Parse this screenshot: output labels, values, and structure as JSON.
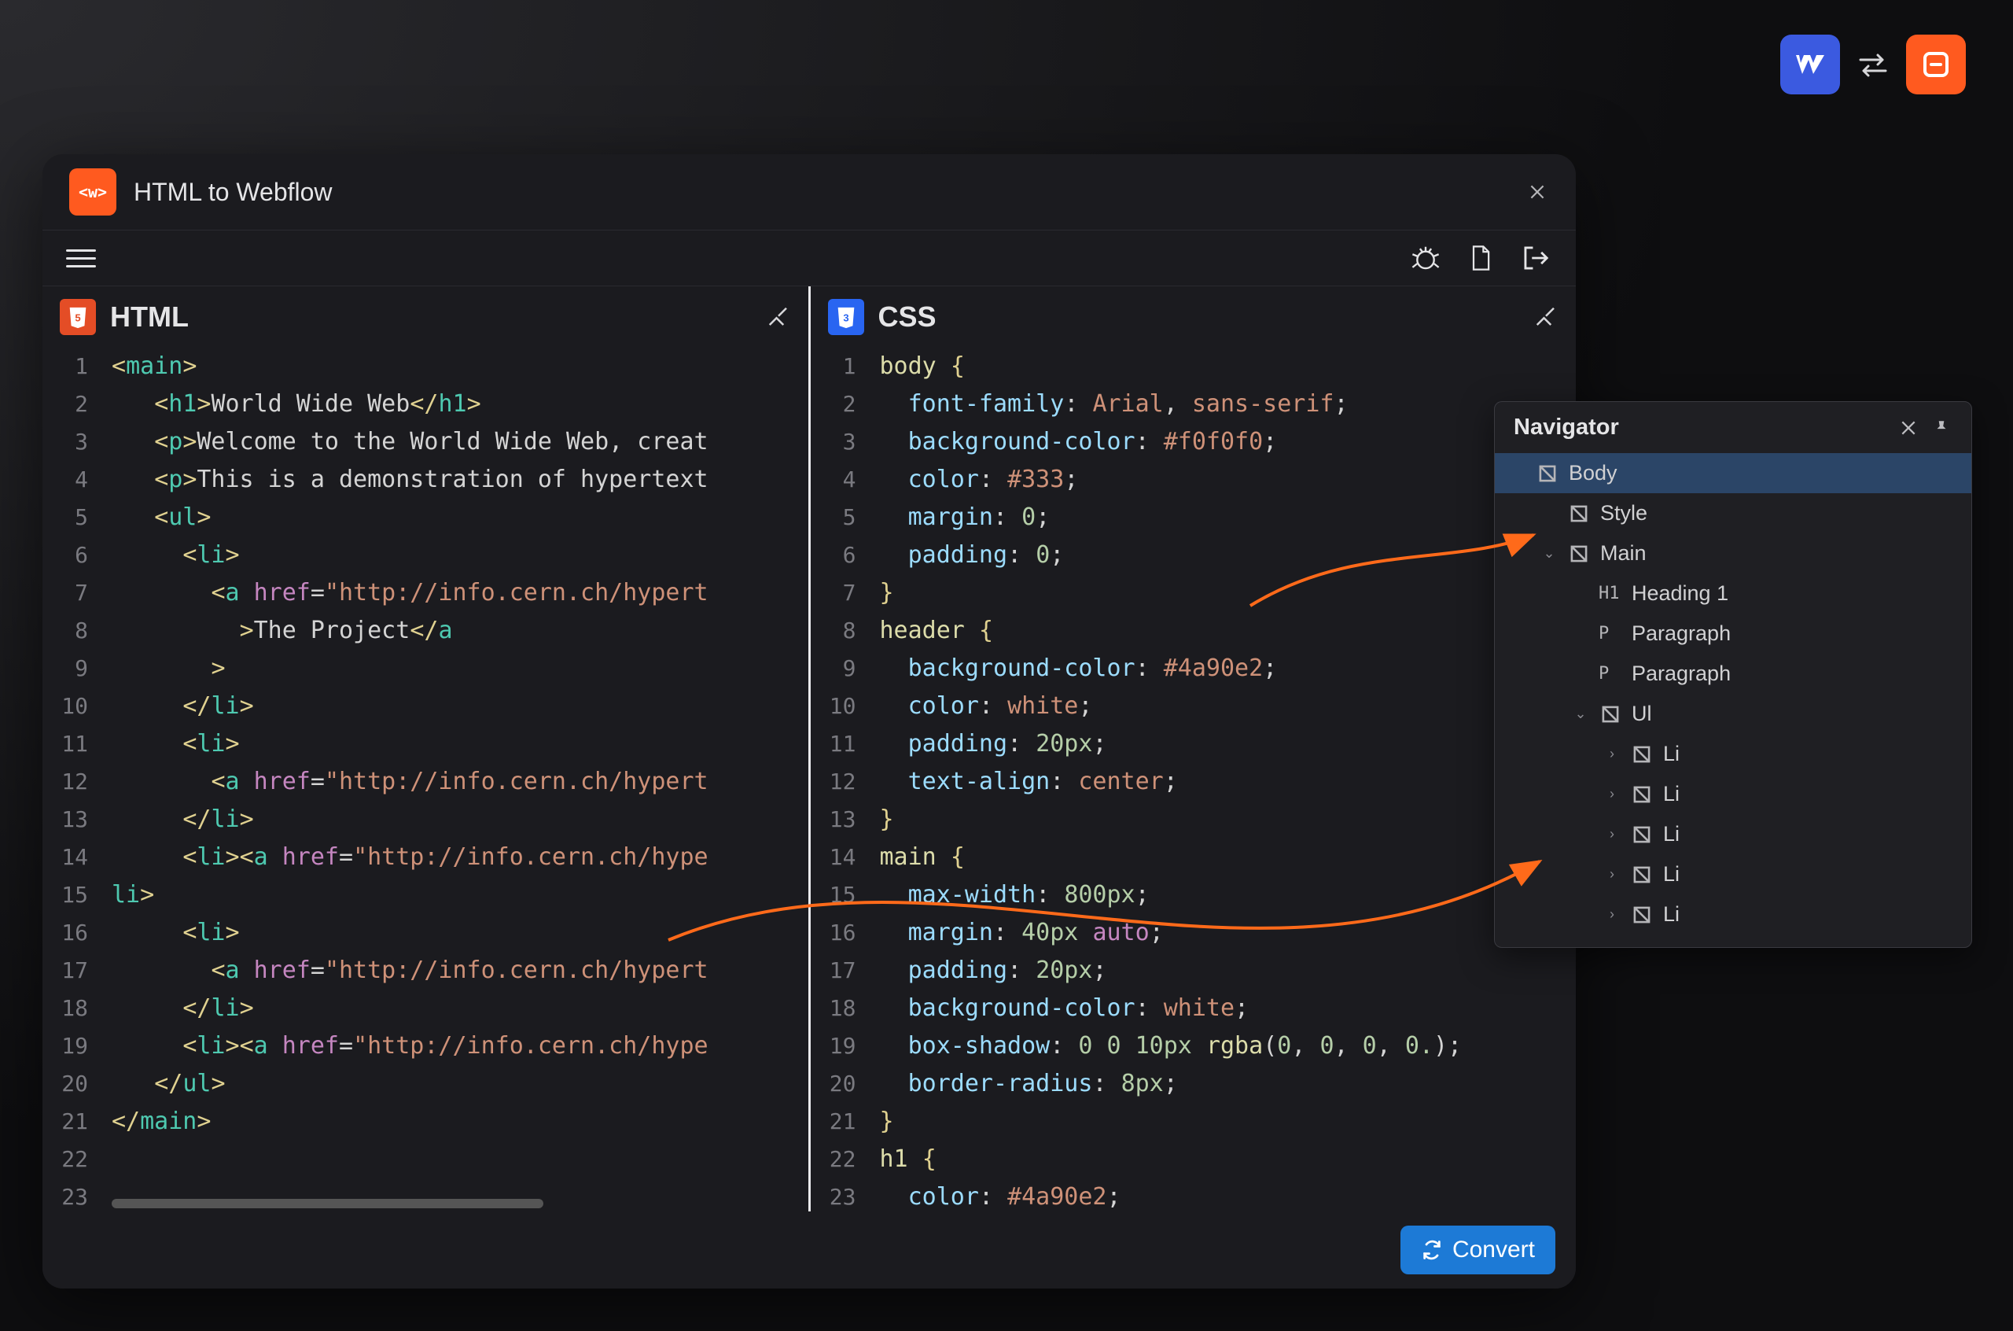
{
  "app": {
    "title": "HTML to Webflow",
    "convert_label": "Convert"
  },
  "logos": {
    "left": "Webflow",
    "right": "GitHub-like"
  },
  "panes": {
    "html_label": "HTML",
    "css_label": "CSS"
  },
  "html_code": {
    "line_numbers": [
      1,
      2,
      3,
      4,
      5,
      6,
      7,
      8,
      9,
      10,
      11,
      12,
      13,
      14,
      15,
      16,
      17,
      18,
      19,
      20,
      21,
      22,
      23
    ],
    "lines": [
      {
        "tokens": [
          [
            "brack",
            "<"
          ],
          [
            "tag",
            "main"
          ],
          [
            "brack",
            ">"
          ]
        ]
      },
      {
        "tokens": [
          [
            "text",
            "   "
          ],
          [
            "brack",
            "<"
          ],
          [
            "tag",
            "h1"
          ],
          [
            "brack",
            ">"
          ],
          [
            "text",
            "World Wide Web"
          ],
          [
            "brack",
            "</"
          ],
          [
            "tag",
            "h1"
          ],
          [
            "brack",
            ">"
          ]
        ]
      },
      {
        "tokens": [
          [
            "text",
            "   "
          ],
          [
            "brack",
            "<"
          ],
          [
            "tag",
            "p"
          ],
          [
            "brack",
            ">"
          ],
          [
            "text",
            "Welcome to the World Wide Web, creat"
          ]
        ]
      },
      {
        "tokens": [
          [
            "text",
            "   "
          ],
          [
            "brack",
            "<"
          ],
          [
            "tag",
            "p"
          ],
          [
            "brack",
            ">"
          ],
          [
            "text",
            "This is a demonstration of hypertext"
          ]
        ]
      },
      {
        "tokens": [
          [
            "text",
            "   "
          ],
          [
            "brack",
            "<"
          ],
          [
            "tag",
            "ul"
          ],
          [
            "brack",
            ">"
          ]
        ]
      },
      {
        "tokens": [
          [
            "text",
            "     "
          ],
          [
            "brack",
            "<"
          ],
          [
            "tag",
            "li"
          ],
          [
            "brack",
            ">"
          ]
        ]
      },
      {
        "tokens": [
          [
            "text",
            "       "
          ],
          [
            "brack",
            "<"
          ],
          [
            "tag",
            "a"
          ],
          [
            "text",
            " "
          ],
          [
            "attr",
            "href"
          ],
          [
            "punct",
            "="
          ],
          [
            "str",
            "\"http://info.cern.ch/hypert"
          ]
        ]
      },
      {
        "tokens": [
          [
            "text",
            "         "
          ],
          [
            "brack",
            ">"
          ],
          [
            "text",
            "The Project"
          ],
          [
            "brack",
            "</"
          ],
          [
            "tag",
            "a"
          ]
        ]
      },
      {
        "tokens": [
          [
            "text",
            "       "
          ],
          [
            "brack",
            ">"
          ]
        ]
      },
      {
        "tokens": [
          [
            "text",
            "     "
          ],
          [
            "brack",
            "</"
          ],
          [
            "tag",
            "li"
          ],
          [
            "brack",
            ">"
          ]
        ]
      },
      {
        "tokens": [
          [
            "text",
            "     "
          ],
          [
            "brack",
            "<"
          ],
          [
            "tag",
            "li"
          ],
          [
            "brack",
            ">"
          ]
        ]
      },
      {
        "tokens": [
          [
            "text",
            "       "
          ],
          [
            "brack",
            "<"
          ],
          [
            "tag",
            "a"
          ],
          [
            "text",
            " "
          ],
          [
            "attr",
            "href"
          ],
          [
            "punct",
            "="
          ],
          [
            "str",
            "\"http://info.cern.ch/hypert"
          ]
        ]
      },
      {
        "tokens": [
          [
            "text",
            "     "
          ],
          [
            "brack",
            "</"
          ],
          [
            "tag",
            "li"
          ],
          [
            "brack",
            ">"
          ]
        ]
      },
      {
        "tokens": [
          [
            "text",
            "     "
          ],
          [
            "brack",
            "<"
          ],
          [
            "tag",
            "li"
          ],
          [
            "brack",
            ">"
          ],
          [
            "brack",
            "<"
          ],
          [
            "tag",
            "a"
          ],
          [
            "text",
            " "
          ],
          [
            "attr",
            "href"
          ],
          [
            "punct",
            "="
          ],
          [
            "str",
            "\"http://info.cern.ch/hype"
          ]
        ]
      },
      {
        "tokens": [
          [
            "tag",
            "li"
          ],
          [
            "brack",
            ">"
          ]
        ]
      },
      {
        "tokens": [
          [
            "text",
            "     "
          ],
          [
            "brack",
            "<"
          ],
          [
            "tag",
            "li"
          ],
          [
            "brack",
            ">"
          ]
        ]
      },
      {
        "tokens": [
          [
            "text",
            "       "
          ],
          [
            "brack",
            "<"
          ],
          [
            "tag",
            "a"
          ],
          [
            "text",
            " "
          ],
          [
            "attr",
            "href"
          ],
          [
            "punct",
            "="
          ],
          [
            "str",
            "\"http://info.cern.ch/hypert"
          ]
        ]
      },
      {
        "tokens": [
          [
            "text",
            "     "
          ],
          [
            "brack",
            "</"
          ],
          [
            "tag",
            "li"
          ],
          [
            "brack",
            ">"
          ]
        ]
      },
      {
        "tokens": [
          [
            "text",
            "     "
          ],
          [
            "brack",
            "<"
          ],
          [
            "tag",
            "li"
          ],
          [
            "brack",
            ">"
          ],
          [
            "brack",
            "<"
          ],
          [
            "tag",
            "a"
          ],
          [
            "text",
            " "
          ],
          [
            "attr",
            "href"
          ],
          [
            "punct",
            "="
          ],
          [
            "str",
            "\"http://info.cern.ch/hype"
          ]
        ]
      },
      {
        "tokens": [
          [
            "text",
            "   "
          ],
          [
            "brack",
            "</"
          ],
          [
            "tag",
            "ul"
          ],
          [
            "brack",
            ">"
          ]
        ]
      },
      {
        "tokens": [
          [
            "brack",
            "</"
          ],
          [
            "tag",
            "main"
          ],
          [
            "brack",
            ">"
          ]
        ]
      },
      {
        "tokens": [
          [
            "text",
            ""
          ]
        ]
      },
      {
        "tokens": [
          [
            "text",
            ""
          ]
        ]
      }
    ]
  },
  "css_code": {
    "line_numbers": [
      1,
      2,
      3,
      4,
      5,
      6,
      7,
      8,
      9,
      10,
      11,
      12,
      13,
      14,
      15,
      16,
      17,
      18,
      19,
      20,
      21,
      22,
      23
    ],
    "lines": [
      {
        "tokens": [
          [
            "sel",
            "body"
          ],
          [
            "text",
            " "
          ],
          [
            "brace",
            "{"
          ]
        ]
      },
      {
        "tokens": [
          [
            "text",
            "  "
          ],
          [
            "prop",
            "font-family"
          ],
          [
            "punct",
            ": "
          ],
          [
            "val",
            "Arial"
          ],
          [
            "punct",
            ", "
          ],
          [
            "val",
            "sans-serif"
          ],
          [
            "punct",
            ";"
          ]
        ]
      },
      {
        "tokens": [
          [
            "text",
            "  "
          ],
          [
            "prop",
            "background-color"
          ],
          [
            "punct",
            ": "
          ],
          [
            "hex",
            "#f0f0f0"
          ],
          [
            "punct",
            ";"
          ]
        ]
      },
      {
        "tokens": [
          [
            "text",
            "  "
          ],
          [
            "prop",
            "color"
          ],
          [
            "punct",
            ": "
          ],
          [
            "hex",
            "#333"
          ],
          [
            "punct",
            ";"
          ]
        ]
      },
      {
        "tokens": [
          [
            "text",
            "  "
          ],
          [
            "prop",
            "margin"
          ],
          [
            "punct",
            ": "
          ],
          [
            "num",
            "0"
          ],
          [
            "punct",
            ";"
          ]
        ]
      },
      {
        "tokens": [
          [
            "text",
            "  "
          ],
          [
            "prop",
            "padding"
          ],
          [
            "punct",
            ": "
          ],
          [
            "num",
            "0"
          ],
          [
            "punct",
            ";"
          ]
        ]
      },
      {
        "tokens": [
          [
            "brace",
            "}"
          ]
        ]
      },
      {
        "tokens": [
          [
            "sel",
            "header"
          ],
          [
            "text",
            " "
          ],
          [
            "brace",
            "{"
          ]
        ]
      },
      {
        "tokens": [
          [
            "text",
            "  "
          ],
          [
            "prop",
            "background-color"
          ],
          [
            "punct",
            ": "
          ],
          [
            "hex",
            "#4a90e2"
          ],
          [
            "punct",
            ";"
          ]
        ]
      },
      {
        "tokens": [
          [
            "text",
            "  "
          ],
          [
            "prop",
            "color"
          ],
          [
            "punct",
            ": "
          ],
          [
            "val",
            "white"
          ],
          [
            "punct",
            ";"
          ]
        ]
      },
      {
        "tokens": [
          [
            "text",
            "  "
          ],
          [
            "prop",
            "padding"
          ],
          [
            "punct",
            ": "
          ],
          [
            "num",
            "20px"
          ],
          [
            "punct",
            ";"
          ]
        ]
      },
      {
        "tokens": [
          [
            "text",
            "  "
          ],
          [
            "prop",
            "text-align"
          ],
          [
            "punct",
            ": "
          ],
          [
            "val",
            "center"
          ],
          [
            "punct",
            ";"
          ]
        ]
      },
      {
        "tokens": [
          [
            "brace",
            "}"
          ]
        ]
      },
      {
        "tokens": [
          [
            "sel",
            "main"
          ],
          [
            "text",
            " "
          ],
          [
            "brace",
            "{"
          ]
        ]
      },
      {
        "tokens": [
          [
            "text",
            "  "
          ],
          [
            "prop",
            "max-width"
          ],
          [
            "punct",
            ": "
          ],
          [
            "num",
            "800px"
          ],
          [
            "punct",
            ";"
          ]
        ]
      },
      {
        "tokens": [
          [
            "text",
            "  "
          ],
          [
            "prop",
            "margin"
          ],
          [
            "punct",
            ": "
          ],
          [
            "num",
            "40px"
          ],
          [
            "text",
            " "
          ],
          [
            "kw",
            "auto"
          ],
          [
            "punct",
            ";"
          ]
        ]
      },
      {
        "tokens": [
          [
            "text",
            "  "
          ],
          [
            "prop",
            "padding"
          ],
          [
            "punct",
            ": "
          ],
          [
            "num",
            "20px"
          ],
          [
            "punct",
            ";"
          ]
        ]
      },
      {
        "tokens": [
          [
            "text",
            "  "
          ],
          [
            "prop",
            "background-color"
          ],
          [
            "punct",
            ": "
          ],
          [
            "val",
            "white"
          ],
          [
            "punct",
            ";"
          ]
        ]
      },
      {
        "tokens": [
          [
            "text",
            "  "
          ],
          [
            "prop",
            "box-shadow"
          ],
          [
            "punct",
            ": "
          ],
          [
            "num",
            "0 0 10px"
          ],
          [
            "text",
            " "
          ],
          [
            "fn",
            "rgba"
          ],
          [
            "punct",
            "("
          ],
          [
            "num",
            "0"
          ],
          [
            "punct",
            ", "
          ],
          [
            "num",
            "0"
          ],
          [
            "punct",
            ", "
          ],
          [
            "num",
            "0"
          ],
          [
            "punct",
            ", "
          ],
          [
            "num",
            "0."
          ],
          [
            "punct",
            ");"
          ]
        ]
      },
      {
        "tokens": [
          [
            "text",
            "  "
          ],
          [
            "prop",
            "border-radius"
          ],
          [
            "punct",
            ": "
          ],
          [
            "num",
            "8px"
          ],
          [
            "punct",
            ";"
          ]
        ]
      },
      {
        "tokens": [
          [
            "brace",
            "}"
          ]
        ]
      },
      {
        "tokens": [
          [
            "sel",
            "h1"
          ],
          [
            "text",
            " "
          ],
          [
            "brace",
            "{"
          ]
        ]
      },
      {
        "tokens": [
          [
            "text",
            "  "
          ],
          [
            "prop",
            "color"
          ],
          [
            "punct",
            ": "
          ],
          [
            "hex",
            "#4a90e2"
          ],
          [
            "punct",
            ";"
          ]
        ]
      }
    ]
  },
  "navigator": {
    "title": "Navigator",
    "items": [
      {
        "depth": 0,
        "chev": "",
        "icon": "box",
        "label": "Body",
        "selected": true
      },
      {
        "depth": 1,
        "chev": "",
        "icon": "box",
        "label": "Style"
      },
      {
        "depth": 1,
        "chev": "v",
        "icon": "box",
        "label": "Main"
      },
      {
        "depth": 2,
        "chev": "",
        "icon": "H1",
        "label": "Heading 1"
      },
      {
        "depth": 2,
        "chev": "",
        "icon": "P",
        "label": "Paragraph"
      },
      {
        "depth": 2,
        "chev": "",
        "icon": "P",
        "label": "Paragraph"
      },
      {
        "depth": 2,
        "chev": "v",
        "icon": "box",
        "label": "Ul"
      },
      {
        "depth": 3,
        "chev": ">",
        "icon": "box",
        "label": "Li"
      },
      {
        "depth": 3,
        "chev": ">",
        "icon": "box",
        "label": "Li"
      },
      {
        "depth": 3,
        "chev": ">",
        "icon": "box",
        "label": "Li"
      },
      {
        "depth": 3,
        "chev": ">",
        "icon": "box",
        "label": "Li"
      },
      {
        "depth": 3,
        "chev": ">",
        "icon": "box",
        "label": "Li"
      }
    ]
  }
}
